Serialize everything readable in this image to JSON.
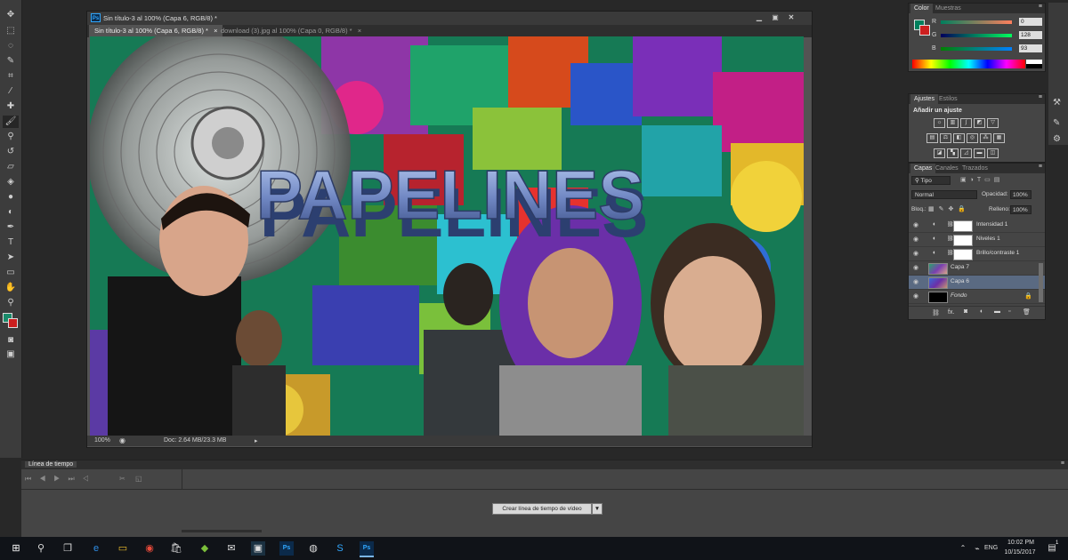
{
  "document": {
    "tabs": [
      {
        "label": "Sin título-3 al 100% (Capa 6, RGB/8) *",
        "close": "×"
      },
      {
        "label": "download (3).jpg al 100% (Capa 0, RGB/8) *",
        "close": "×"
      }
    ],
    "title": "Sin título-3 al 100% (Capa 6, RGB/8) *",
    "ps_label": "Ps",
    "canvas_text": "PAPELINES",
    "zoom": "100%",
    "doc_info": "Doc: 2.64 MB/23.3 MB"
  },
  "color_panel": {
    "tabs": [
      "Color",
      "Muestras"
    ],
    "channels": [
      {
        "label": "R",
        "value": "0"
      },
      {
        "label": "G",
        "value": "128"
      },
      {
        "label": "B",
        "value": "93"
      }
    ],
    "foreground_color": "#00805d",
    "background_color": "#cc1f1f"
  },
  "adjust_panel": {
    "tabs": [
      "Ajustes",
      "Estilos"
    ],
    "heading": "Añadir un ajuste"
  },
  "layers_panel": {
    "tabs": [
      "Capas",
      "Canales",
      "Trazados"
    ],
    "filter": "Tipo",
    "blend_mode": "Normal",
    "opacity_label": "Opacidad:",
    "opacity": "100%",
    "lock_label": "Bloq.:",
    "fill_label": "Relleno:",
    "fill": "100%",
    "layers": [
      {
        "name": "Intensidad 1",
        "type": "adjustment",
        "selected": false
      },
      {
        "name": "Niveles 1",
        "type": "adjustment",
        "selected": false
      },
      {
        "name": "Brillo/contraste 1",
        "type": "adjustment",
        "selected": false
      },
      {
        "name": "Capa 7",
        "type": "image",
        "selected": false
      },
      {
        "name": "Capa 6",
        "type": "image",
        "selected": true
      },
      {
        "name": "Fondo",
        "type": "background",
        "selected": false
      }
    ],
    "footer_label": "fx."
  },
  "timeline": {
    "title": "Línea de tiempo",
    "create_button": "Crear línea de tiempo de vídeo"
  },
  "taskbar": {
    "lang": "ENG",
    "time": "10:02 PM",
    "date": "10/15/2017",
    "notif_count": "1"
  }
}
